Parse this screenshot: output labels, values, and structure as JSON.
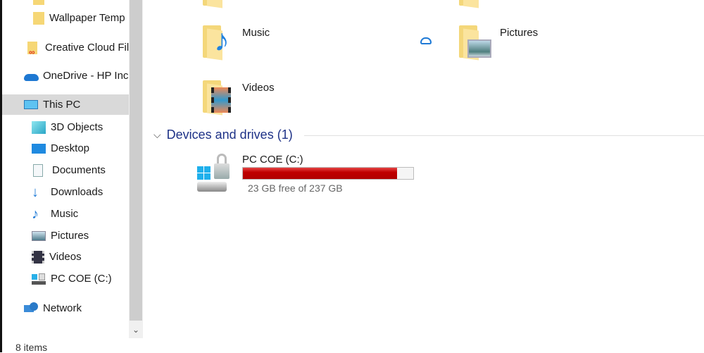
{
  "sidebar": {
    "items": [
      {
        "label": "Wallpaper Temp",
        "icon": "folder-icon"
      },
      {
        "label": "Creative Cloud Fil",
        "icon": "creative-cloud-icon"
      },
      {
        "label": "OneDrive - HP Inc",
        "icon": "onedrive-icon"
      },
      {
        "label": "This PC",
        "icon": "computer-icon",
        "selected": true
      },
      {
        "label": "3D Objects",
        "icon": "cube-icon"
      },
      {
        "label": "Desktop",
        "icon": "desktop-icon"
      },
      {
        "label": "Documents",
        "icon": "document-icon"
      },
      {
        "label": "Downloads",
        "icon": "download-arrow-icon"
      },
      {
        "label": "Music",
        "icon": "music-note-icon"
      },
      {
        "label": "Pictures",
        "icon": "picture-icon"
      },
      {
        "label": "Videos",
        "icon": "film-icon"
      },
      {
        "label": "PC COE (C:)",
        "icon": "drive-icon"
      },
      {
        "label": "Network",
        "icon": "network-icon"
      }
    ]
  },
  "status": {
    "items": "8 items"
  },
  "folders": [
    {
      "label": "Music",
      "icon": "music-folder-icon"
    },
    {
      "label": "Pictures",
      "icon": "pictures-folder-icon",
      "cloud_status": "cloud-icon"
    },
    {
      "label": "Videos",
      "icon": "videos-folder-icon"
    }
  ],
  "devices": {
    "header": "Devices and drives (1)",
    "drives": [
      {
        "name": "PC COE (C:)",
        "free": "23 GB free of 237 GB",
        "used_percent": 90.3,
        "bar_color": "#c00000"
      }
    ]
  },
  "colors": {
    "selected": "#d9d9d9",
    "group_header": "#1e3287",
    "accent": "#0078d7"
  }
}
